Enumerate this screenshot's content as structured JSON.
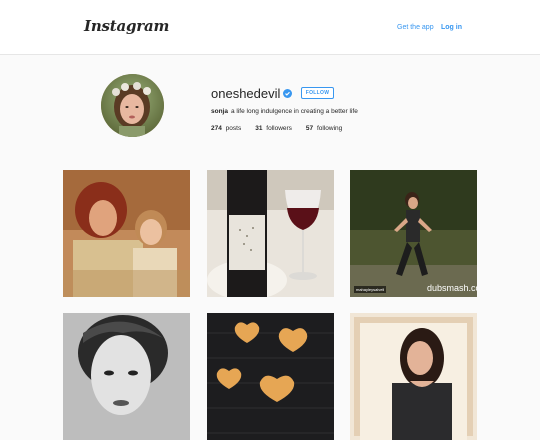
{
  "header": {
    "logo": "Instagram",
    "get_app": "Get the app",
    "log_in": "Log in"
  },
  "profile": {
    "username": "oneshedevil",
    "verified": true,
    "follow_label": "FOLLOW",
    "display_name": "sonja",
    "bio": "a life long indulgence in creating a better life",
    "posts_count": "274",
    "posts_label": "posts",
    "followers_count": "31",
    "followers_label": "followers",
    "following_count": "57",
    "following_label": "following"
  },
  "posts": [
    {
      "name": "vintage-family-photo"
    },
    {
      "name": "wine-bottle-photo"
    },
    {
      "name": "dubsmash-video",
      "watermark": "dubsmash.com",
      "handle": "mahayleysalvell"
    },
    {
      "name": "black-white-portrait"
    },
    {
      "name": "heart-cookies-photo"
    },
    {
      "name": "woman-portrait-photo"
    }
  ],
  "colors": {
    "accent": "#3897f0",
    "background": "#fafafa",
    "text": "#262626"
  }
}
